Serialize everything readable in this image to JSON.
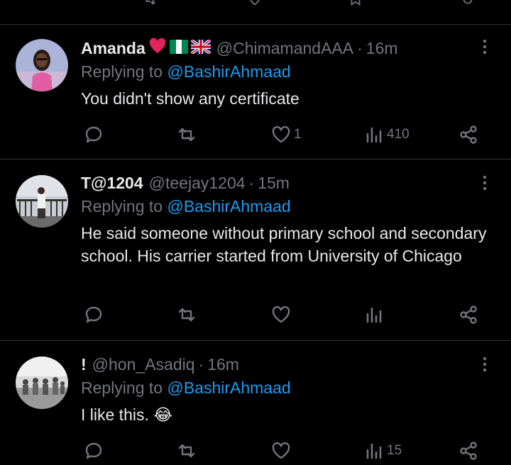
{
  "tweets": [
    {
      "name": "Amanda",
      "handle": "@ChimamandAAA",
      "dot": "·",
      "time": "16m",
      "replying_prefix": "Replying to",
      "replying_to": "@BashirAhmaad",
      "text": "You didn't show any certificate",
      "likes": "1",
      "views": "410"
    },
    {
      "name": "T@1204",
      "handle": "@teejay1204",
      "dot": "·",
      "time": "15m",
      "replying_prefix": "Replying to",
      "replying_to": "@BashirAhmaad",
      "text": "He said someone without primary school and secondary school. His carrier started from University of Chicago",
      "likes": "",
      "views": ""
    },
    {
      "name": "!",
      "handle": "@hon_Asadiq",
      "dot": "·",
      "time": "16m",
      "replying_prefix": "Replying to",
      "replying_to": "@BashirAhmaad",
      "text": "I like this. 😂",
      "likes": "",
      "views": "15"
    }
  ],
  "icons": {
    "reply": "speech-bubble",
    "retweet": "retweet-arrows",
    "like": "heart",
    "views": "bar-chart",
    "share": "share-nodes",
    "more": "vertical-ellipsis"
  },
  "colors": {
    "background": "#000000",
    "text": "#e7e9ea",
    "muted": "#71767b",
    "link": "#1d9bf0",
    "divider": "#2f3336",
    "heart_emoji": "#e0245e"
  }
}
